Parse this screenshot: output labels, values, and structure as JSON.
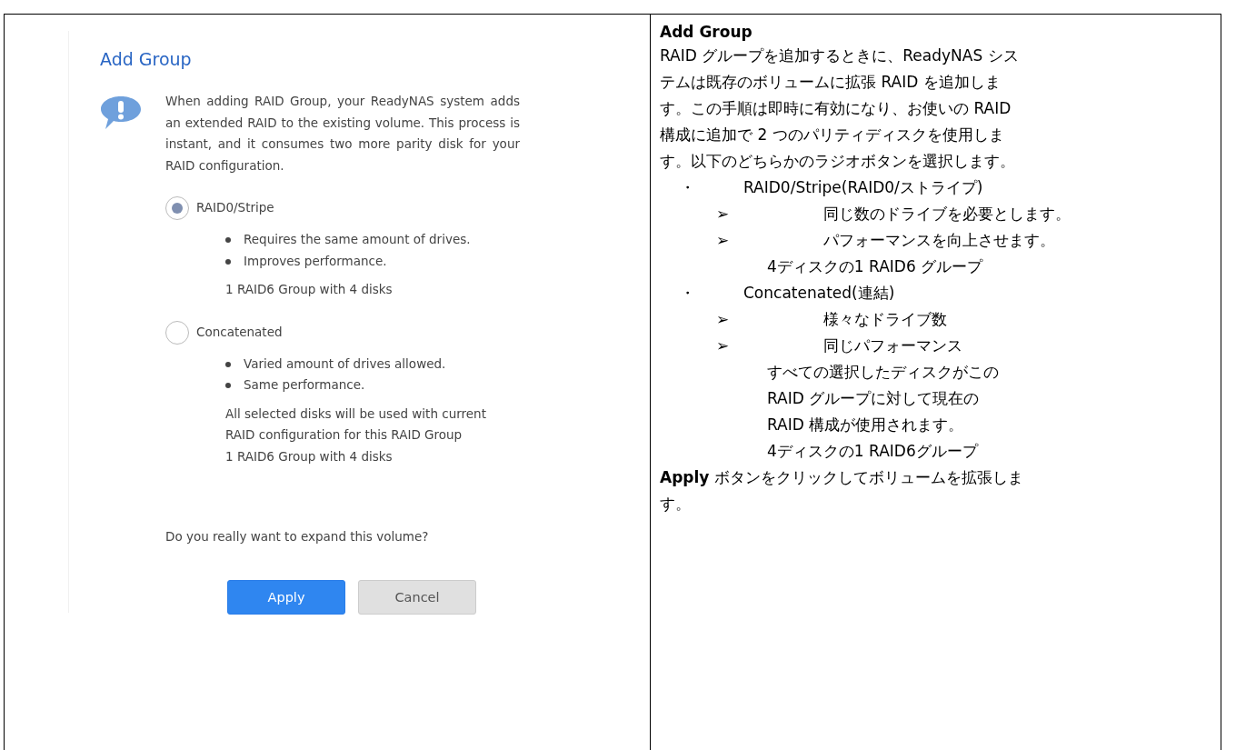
{
  "dialog": {
    "title": "Add Group",
    "message": "When adding RAID Group, your ReadyNAS system adds an extended RAID to the existing volume. This process is instant, and it consumes two more parity disk for your RAID configuration.",
    "options": [
      {
        "label": "RAID0/Stripe",
        "selected": true,
        "bullets": [
          "Requires the same amount of drives.",
          "Improves performance."
        ],
        "notes": [
          "1 RAID6 Group with 4 disks"
        ]
      },
      {
        "label": "Concatenated",
        "selected": false,
        "bullets": [
          "Varied amount of drives allowed.",
          "Same performance."
        ],
        "notes": [
          "All selected disks will be used with current RAID configuration for this RAID Group",
          "1 RAID6 Group with 4 disks"
        ]
      }
    ],
    "question": "Do you really want to expand this volume?",
    "buttons": [
      {
        "label": "Apply",
        "kind": "primary"
      },
      {
        "label": "Cancel",
        "kind": "secondary"
      }
    ]
  },
  "description": {
    "title": "Add Group",
    "intro": "RAID グループを追加するときに、ReadyNAS システムは既存のボリュームに拡張 RAID を追加します。この手順は即時に有効になり、お使いの RAID 構成に追加で 2 つのパリティディスクを使用します。以下のどちらかのラジオボタンを選択します。",
    "options": [
      {
        "marker": "・",
        "label": "RAID0/Stripe(RAID0/ストライプ)",
        "points": [
          {
            "marker": "➢",
            "text": "同じ数のドライブを必要とします。"
          },
          {
            "marker": "➢",
            "text": "パフォーマンスを向上させます。"
          }
        ],
        "notes": [
          "4ディスクの1 RAID6 グループ"
        ]
      },
      {
        "marker": "・",
        "label": "Concatenated(連結)",
        "points": [
          {
            "marker": "➢",
            "text": "様々なドライブ数"
          },
          {
            "marker": "➢",
            "text": "同じパフォーマンス"
          }
        ],
        "notes": [
          "すべての選択したディスクがこの RAID グループに対して現在の RAID 構成が使用されます。",
          "4ディスクの1 RAID6グループ"
        ]
      }
    ],
    "footer": "**Apply** ボタンをクリックしてボリュームを拡張します。"
  }
}
